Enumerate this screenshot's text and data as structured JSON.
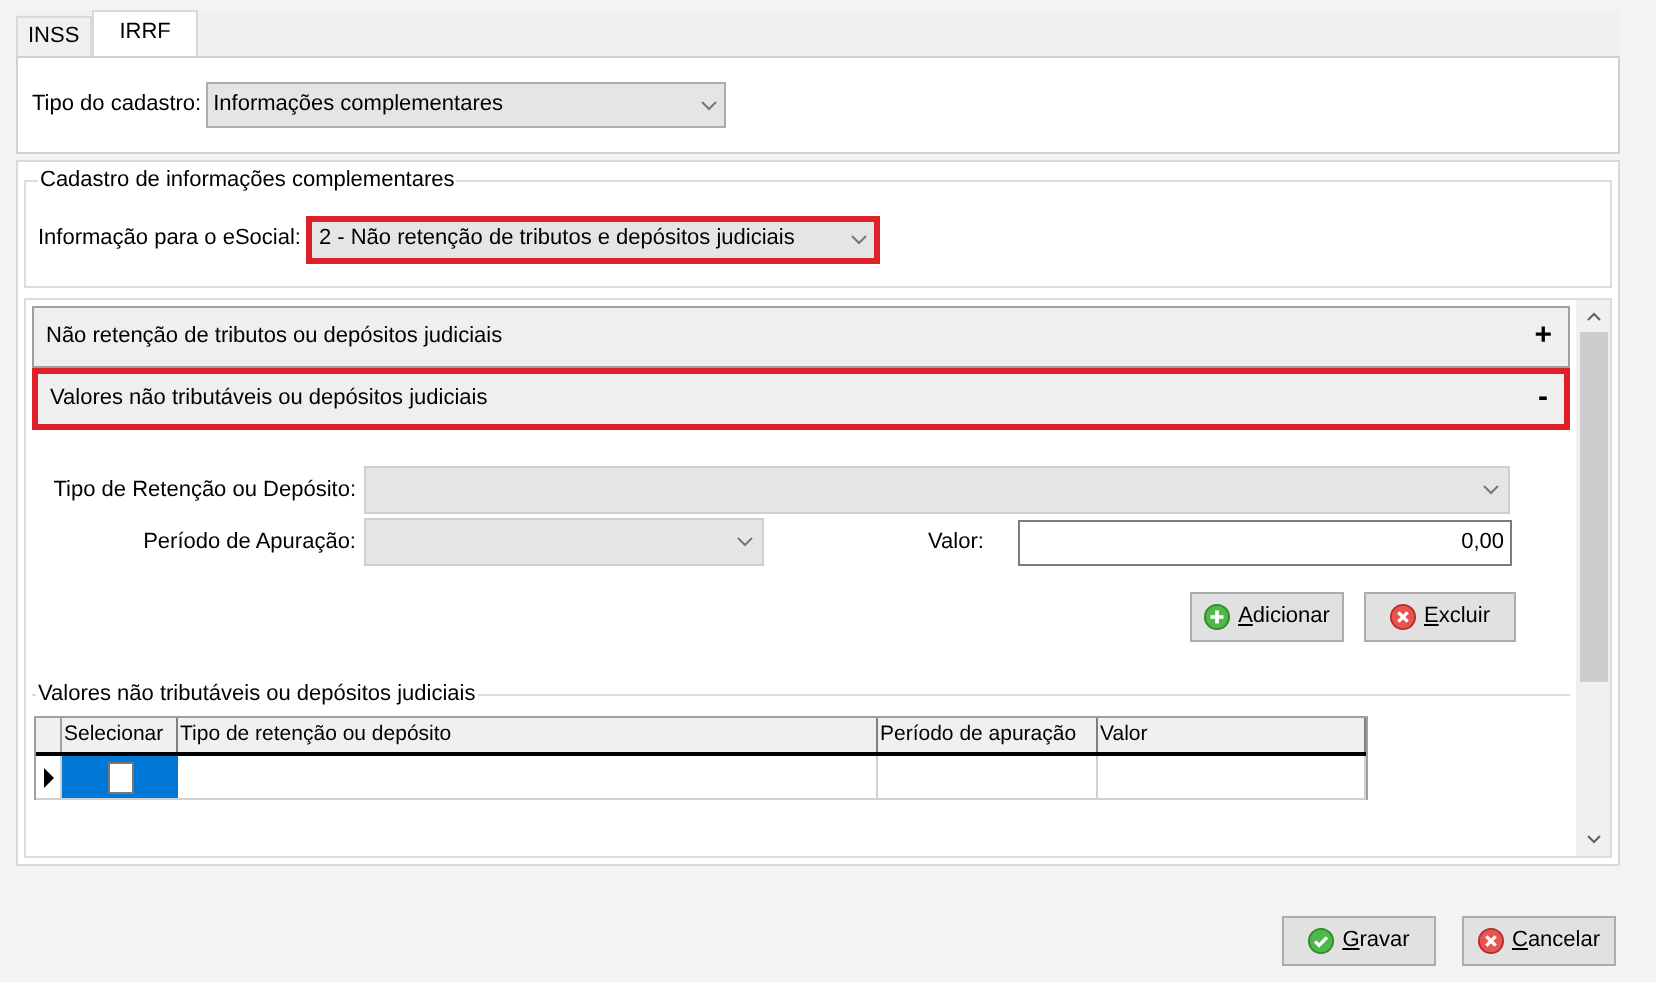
{
  "tabs": [
    {
      "label": "INSS",
      "selected": false
    },
    {
      "label": "IRRF",
      "selected": true
    }
  ],
  "tipo_cadastro": {
    "label": "Tipo do cadastro:",
    "value": "Informações complementares"
  },
  "group": {
    "legend": "Cadastro de informações complementares",
    "label": "Informação para o eSocial:",
    "value": "2 - Não retenção de tributos e depósitos judiciais",
    "highlighted": true
  },
  "sections": [
    {
      "title": "Não retenção de tributos ou depósitos judiciais",
      "toggle": "+",
      "highlighted": false
    },
    {
      "title": "Valores não tributáveis ou depósitos judiciais",
      "toggle": "-",
      "highlighted": true
    }
  ],
  "form": {
    "tipo_label": "Tipo de Retenção ou Depósito:",
    "periodo_label": "Período de Apuração:",
    "valor_label": "Valor:",
    "valor": "0,00"
  },
  "form_buttons": [
    {
      "label": "Adicionar",
      "kind": "add",
      "mnemonic_first": true
    },
    {
      "label": "Excluir",
      "kind": "delete",
      "mnemonic_first": true
    }
  ],
  "table": {
    "legend": "Valores não tributáveis ou depósitos judiciais",
    "columns": [
      "Selecionar",
      "Tipo de retenção ou depósito",
      "Período de apuração",
      "Valor"
    ],
    "rows": [
      {
        "current": true,
        "selected": true,
        "checked": false
      }
    ]
  },
  "buttons": [
    {
      "label": "Gravar",
      "kind": "ok",
      "mnemonic_first": true
    },
    {
      "label": "Cancelar",
      "kind": "cancel",
      "mnemonic_first": true
    }
  ]
}
